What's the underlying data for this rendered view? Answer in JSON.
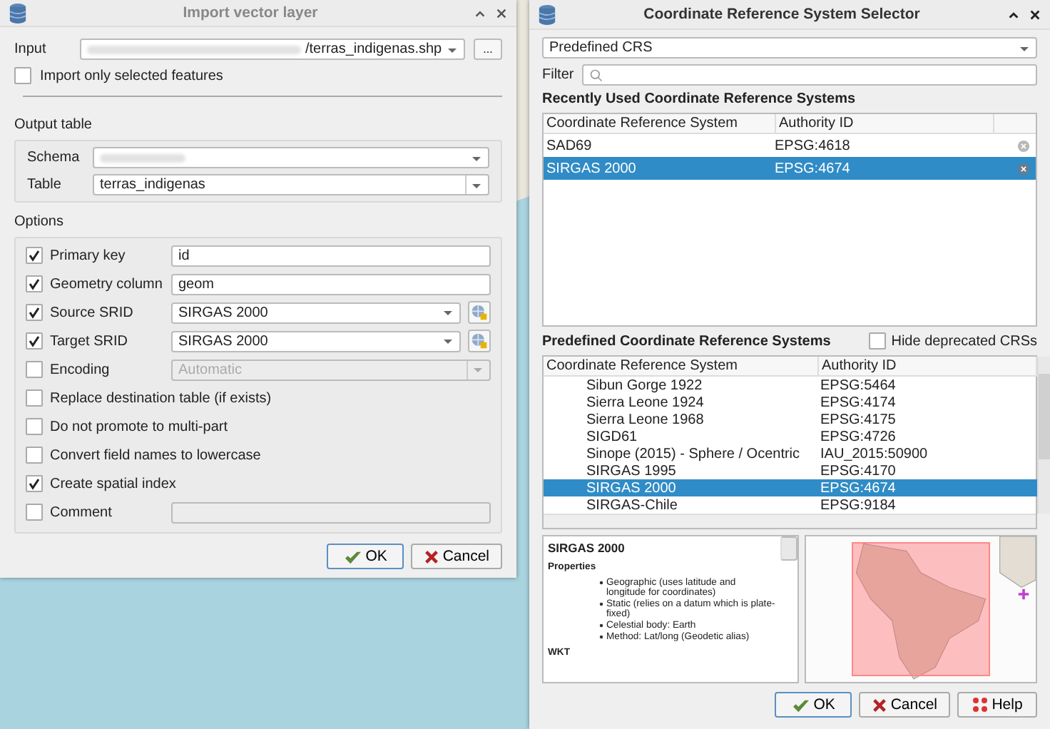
{
  "import_dialog": {
    "title": "Import vector layer",
    "input": {
      "label": "Input",
      "value": "/terras_indigenas.shp",
      "browse": "..."
    },
    "only_selected": {
      "label": "Import only selected features",
      "checked": false
    },
    "output_table": {
      "title": "Output table",
      "schema_label": "Schema",
      "table_label": "Table",
      "table_value": "terras_indigenas"
    },
    "options": {
      "title": "Options",
      "rows": [
        {
          "kind": "text",
          "label": "Primary key",
          "checked": true,
          "disabled": false,
          "value": "id"
        },
        {
          "kind": "text",
          "label": "Geometry column",
          "checked": true,
          "disabled": false,
          "value": "geom"
        },
        {
          "kind": "crs",
          "label": "Source SRID",
          "checked": true,
          "disabled": false,
          "value": "SIRGAS 2000"
        },
        {
          "kind": "crs",
          "label": "Target SRID",
          "checked": true,
          "disabled": false,
          "value": "SIRGAS 2000"
        },
        {
          "kind": "select",
          "label": "Encoding",
          "checked": false,
          "disabled": true,
          "value": "Automatic"
        },
        {
          "kind": "check",
          "label": "Replace destination table (if exists)",
          "checked": false,
          "disabled": false
        },
        {
          "kind": "check",
          "label": "Do not promote to multi-part",
          "checked": false,
          "disabled": false
        },
        {
          "kind": "check",
          "label": "Convert field names to lowercase",
          "checked": false,
          "disabled": false
        },
        {
          "kind": "check",
          "label": "Create spatial index",
          "checked": true,
          "disabled": false
        },
        {
          "kind": "text",
          "label": "Comment",
          "checked": false,
          "disabled": true
        }
      ]
    },
    "buttons": [
      {
        "kind": "ok",
        "label": "OK",
        "default": true
      },
      {
        "kind": "cancel",
        "label": "Cancel",
        "default": false
      }
    ]
  },
  "crs_dialog": {
    "title": "Coordinate Reference System Selector",
    "mode": "Predefined CRS",
    "filter_label": "Filter",
    "recent": {
      "title": "Recently Used Coordinate Reference Systems",
      "columns": [
        "Coordinate Reference System",
        "Authority ID"
      ],
      "rows": [
        {
          "name": "SAD69",
          "authority_id": "EPSG:4618",
          "selected": false
        },
        {
          "name": "SIRGAS 2000",
          "authority_id": "EPSG:4674",
          "selected": true
        }
      ]
    },
    "predefined": {
      "title": "Predefined Coordinate Reference Systems",
      "hide_deprecated": {
        "label": "Hide deprecated CRSs",
        "checked": false
      },
      "columns": [
        "Coordinate Reference System",
        "Authority ID"
      ],
      "rows": [
        {
          "name": "Sibun Gorge 1922",
          "authority_id": "EPSG:5464",
          "selected": false
        },
        {
          "name": "Sierra Leone 1924",
          "authority_id": "EPSG:4174",
          "selected": false
        },
        {
          "name": "Sierra Leone 1968",
          "authority_id": "EPSG:4175",
          "selected": false
        },
        {
          "name": "SIGD61",
          "authority_id": "EPSG:4726",
          "selected": false
        },
        {
          "name": "Sinope (2015) - Sphere / Ocentric",
          "authority_id": "IAU_2015:50900",
          "selected": false
        },
        {
          "name": "SIRGAS 1995",
          "authority_id": "EPSG:4170",
          "selected": false
        },
        {
          "name": "SIRGAS 2000",
          "authority_id": "EPSG:4674",
          "selected": true
        },
        {
          "name": "SIRGAS-Chile",
          "authority_id": "EPSG:9184",
          "selected": false
        }
      ]
    },
    "details": {
      "title": "SIRGAS 2000",
      "heading": "Properties",
      "bullets": [
        "Geographic (uses latitude and longitude for coordinates)",
        "Static (relies on a datum which is plate-fixed)",
        "Celestial body: Earth",
        "Method: Lat/long (Geodetic alias)"
      ],
      "section": "WKT"
    },
    "buttons": [
      {
        "kind": "ok",
        "label": "OK",
        "default": true
      },
      {
        "kind": "cancel",
        "label": "Cancel",
        "default": false
      },
      {
        "kind": "help",
        "label": "Help",
        "default": false
      }
    ]
  }
}
